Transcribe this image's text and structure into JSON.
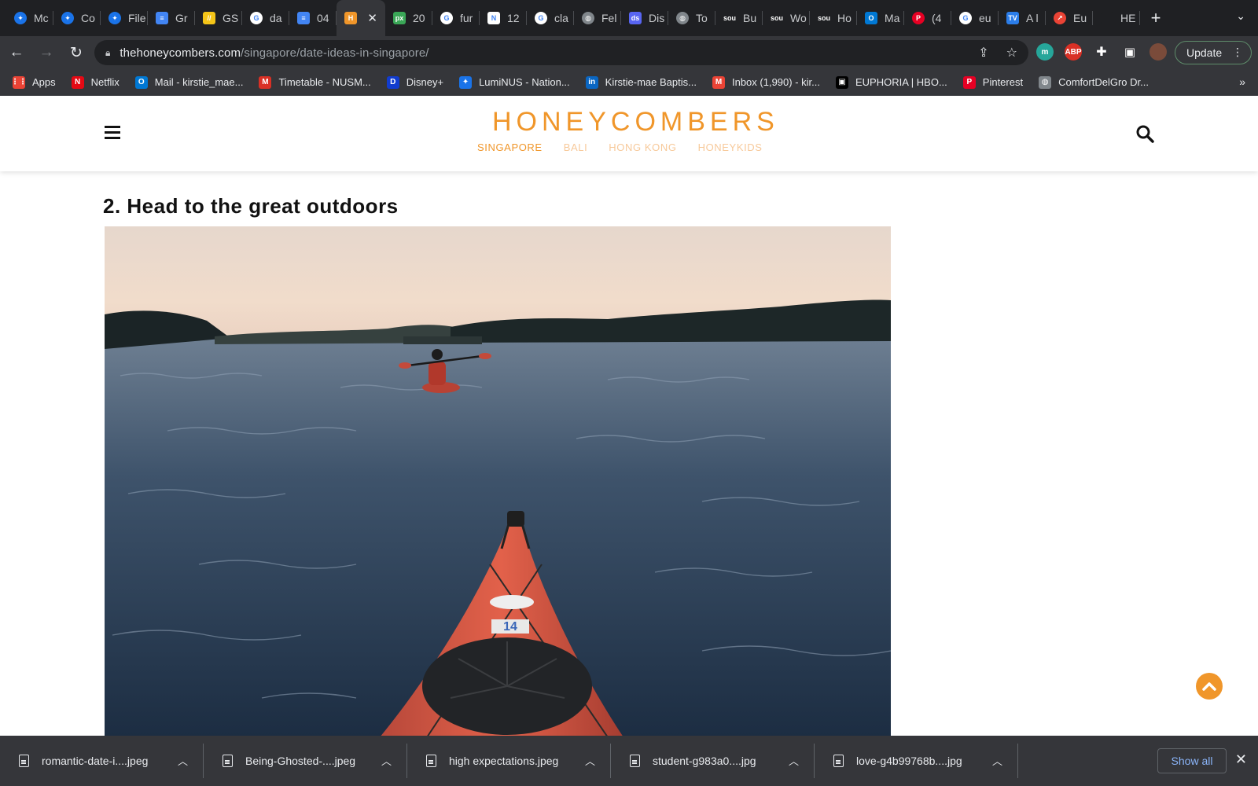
{
  "browser": {
    "tabs": [
      {
        "title": "Mc",
        "fav": "#1a73e8",
        "glyph": "✦",
        "round": true
      },
      {
        "title": "Co",
        "fav": "#1a73e8",
        "glyph": "✦",
        "round": true
      },
      {
        "title": "File",
        "fav": "#1a73e8",
        "glyph": "✦",
        "round": true
      },
      {
        "title": "Gr",
        "fav": "#4285f4",
        "glyph": "≡",
        "round": false
      },
      {
        "title": "GS",
        "fav": "#f5c518",
        "glyph": "//",
        "round": false
      },
      {
        "title": "da",
        "fav": "#ffffff",
        "glyph": "G",
        "round": true
      },
      {
        "title": "04",
        "fav": "#4285f4",
        "glyph": "≡",
        "round": false
      },
      {
        "title": "",
        "fav": "#f0962a",
        "glyph": "H",
        "round": false
      },
      {
        "title": "20",
        "fav": "#3aa757",
        "glyph": "px",
        "round": false
      },
      {
        "title": "fur",
        "fav": "#ffffff",
        "glyph": "G",
        "round": true
      },
      {
        "title": "12",
        "fav": "#ffffff",
        "glyph": "N",
        "round": false
      },
      {
        "title": "cla",
        "fav": "#ffffff",
        "glyph": "G",
        "round": true
      },
      {
        "title": "Fel",
        "fav": "#80868b",
        "glyph": "◍",
        "round": true
      },
      {
        "title": "Dis",
        "fav": "#5865f2",
        "glyph": "ds",
        "round": false
      },
      {
        "title": "To",
        "fav": "#80868b",
        "glyph": "◍",
        "round": true
      },
      {
        "title": "Bu",
        "fav": "#1f2023",
        "glyph": "sou",
        "round": false
      },
      {
        "title": "Wo",
        "fav": "#1f2023",
        "glyph": "sou",
        "round": false
      },
      {
        "title": "Ho",
        "fav": "#1f2023",
        "glyph": "sou",
        "round": false
      },
      {
        "title": "Ma",
        "fav": "#0078d4",
        "glyph": "O",
        "round": false
      },
      {
        "title": "(4",
        "fav": "#e60023",
        "glyph": "P",
        "round": true
      },
      {
        "title": "eu",
        "fav": "#ffffff",
        "glyph": "G",
        "round": true
      },
      {
        "title": "A l",
        "fav": "#2b7de9",
        "glyph": "TV",
        "round": false
      },
      {
        "title": "Eu",
        "fav": "#ea4335",
        "glyph": "↗",
        "round": true
      },
      {
        "title": "HE",
        "fav": "#1f2023",
        "glyph": "",
        "round": false
      }
    ],
    "active_tab_index": 7,
    "address": {
      "host": "thehoneycombers.com",
      "path": "/singapore/date-ideas-in-singapore/"
    },
    "update_label": "Update",
    "bookmarks": [
      {
        "label": "Apps",
        "color": "#ea4335",
        "glyph": "⋮⋮"
      },
      {
        "label": "Netflix",
        "color": "#e50914",
        "glyph": "N"
      },
      {
        "label": "Mail - kirstie_mae...",
        "color": "#0078d4",
        "glyph": "O"
      },
      {
        "label": "Timetable - NUSM...",
        "color": "#d93025",
        "glyph": "M"
      },
      {
        "label": "Disney+",
        "color": "#113ccf",
        "glyph": "D"
      },
      {
        "label": "LumiNUS - Nation...",
        "color": "#1a73e8",
        "glyph": "✦"
      },
      {
        "label": "Kirstie-mae Baptis...",
        "color": "#0a66c2",
        "glyph": "in"
      },
      {
        "label": "Inbox (1,990) - kir...",
        "color": "#ea4335",
        "glyph": "M"
      },
      {
        "label": "EUPHORIA | HBO...",
        "color": "#000000",
        "glyph": "▣"
      },
      {
        "label": "Pinterest",
        "color": "#e60023",
        "glyph": "P"
      },
      {
        "label": "ComfortDelGro Dr...",
        "color": "#80868b",
        "glyph": "◍"
      }
    ]
  },
  "site": {
    "logo": "HONEYCOMBERS",
    "regions": [
      "SINGAPORE",
      "BALI",
      "HONG KONG",
      "HONEYKIDS"
    ],
    "current_region": "SINGAPORE",
    "accent": "#f0962a"
  },
  "article": {
    "section_heading": "2. Head to the great outdoors",
    "kayak_number": "14"
  },
  "downloads": {
    "items": [
      "romantic-date-i....jpeg",
      "Being-Ghosted-....jpeg",
      "high expectations.jpeg",
      "student-g983a0....jpg",
      "love-g4b99768b....jpg"
    ],
    "show_all_label": "Show all"
  }
}
